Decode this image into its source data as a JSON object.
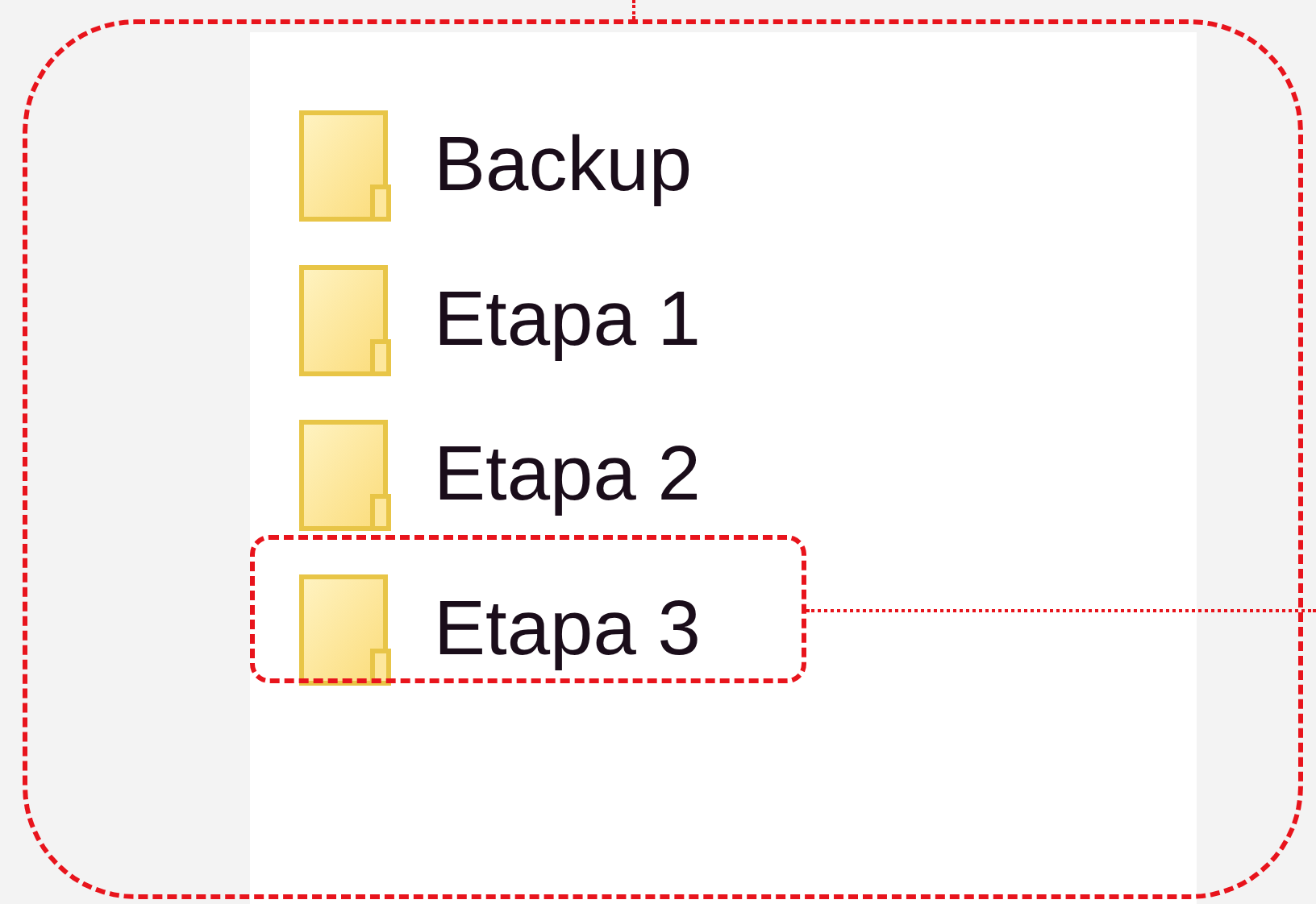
{
  "folders": [
    {
      "name": "Backup",
      "highlighted": false
    },
    {
      "name": "Etapa 1",
      "highlighted": false
    },
    {
      "name": "Etapa 2",
      "highlighted": false
    },
    {
      "name": "Etapa 3",
      "highlighted": true
    }
  ]
}
